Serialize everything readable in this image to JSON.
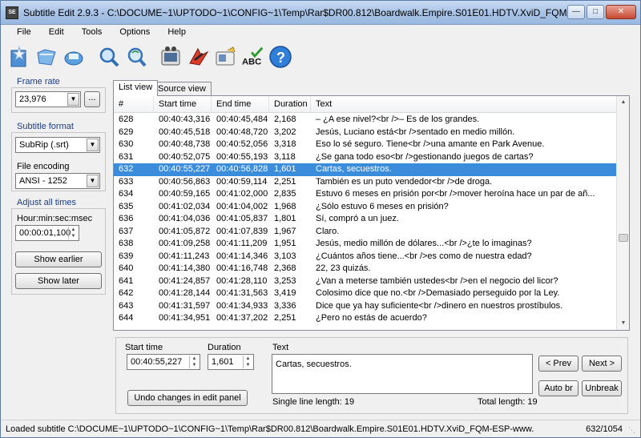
{
  "window": {
    "title": "Subtitle Edit 2.9.3 - C:\\DOCUME~1\\UPTODO~1\\CONFIG~1\\Temp\\Rar$DR00.812\\Boardwalk.Empire.S01E01.HDTV.XviD_FQM-ESP-www...",
    "app_icon_text": "SE"
  },
  "menu": [
    "File",
    "Edit",
    "Tools",
    "Options",
    "Help"
  ],
  "toolbar": {
    "icons": [
      "wizard-icon",
      "open-file-icon",
      "save-icon",
      "find-icon",
      "replace-icon",
      "video-icon",
      "fix-errors-icon",
      "spellcheck-icon",
      "help-icon"
    ],
    "spellcheck_label": "ABC"
  },
  "left_panel": {
    "frame_rate_label": "Frame rate",
    "frame_rate_value": "23,976",
    "frame_rate_browse": "...",
    "subtitle_format_label": "Subtitle format",
    "subtitle_format_value": "SubRip (.srt)",
    "file_encoding_label": "File encoding",
    "file_encoding_value": "ANSI - 1252",
    "adjust_label": "Adjust all times",
    "hms_label": "Hour:min:sec:msec",
    "adjust_value": "00:00:01,100",
    "show_earlier": "Show earlier",
    "show_later": "Show later"
  },
  "tabs": [
    "List view",
    "Source view"
  ],
  "grid": {
    "columns": [
      "#",
      "Start time",
      "End time",
      "Duration",
      "Text"
    ],
    "rows": [
      [
        "628",
        "00:40:43,316",
        "00:40:45,484",
        "2,168",
        "– ¿A ese nivel?<br />– Es de los grandes."
      ],
      [
        "629",
        "00:40:45,518",
        "00:40:48,720",
        "3,202",
        "Jesús, Luciano está<br />sentado en medio millón."
      ],
      [
        "630",
        "00:40:48,738",
        "00:40:52,056",
        "3,318",
        "Eso lo sé seguro. Tiene<br />una amante en Park Avenue."
      ],
      [
        "631",
        "00:40:52,075",
        "00:40:55,193",
        "3,118",
        "¿Se gana todo eso<br />gestionando juegos de cartas?"
      ],
      [
        "632",
        "00:40:55,227",
        "00:40:56,828",
        "1,601",
        "Cartas, secuestros."
      ],
      [
        "633",
        "00:40:56,863",
        "00:40:59,114",
        "2,251",
        "También es un puto vendedor<br />de droga."
      ],
      [
        "634",
        "00:40:59,165",
        "00:41:02,000",
        "2,835",
        "Estuvo 6 meses en prisión por<br />mover heroína hace un par de añ..."
      ],
      [
        "635",
        "00:41:02,034",
        "00:41:04,002",
        "1,968",
        "¿Sólo estuvo 6 meses en prisión?"
      ],
      [
        "636",
        "00:41:04,036",
        "00:41:05,837",
        "1,801",
        "Sí, compró a un juez."
      ],
      [
        "637",
        "00:41:05,872",
        "00:41:07,839",
        "1,967",
        "Claro."
      ],
      [
        "638",
        "00:41:09,258",
        "00:41:11,209",
        "1,951",
        "Jesús, medio millón de dólares...<br />¿te lo imaginas?"
      ],
      [
        "639",
        "00:41:11,243",
        "00:41:14,346",
        "3,103",
        "¿Cuántos años tiene...<br />es como de nuestra edad?"
      ],
      [
        "640",
        "00:41:14,380",
        "00:41:16,748",
        "2,368",
        "22, 23 quizás."
      ],
      [
        "641",
        "00:41:24,857",
        "00:41:28,110",
        "3,253",
        "¿Van a meterse también ustedes<br />en el negocio del licor?"
      ],
      [
        "642",
        "00:41:28,144",
        "00:41:31,563",
        "3,419",
        "Colosimo dice que no.<br />Demasiado perseguido por la Ley."
      ],
      [
        "643",
        "00:41:31,597",
        "00:41:34,933",
        "3,336",
        "Dice que ya hay suficiente<br />dinero en nuestros prostíbulos."
      ],
      [
        "644",
        "00:41:34,951",
        "00:41:37,202",
        "2,251",
        "¿Pero no estás de acuerdo?"
      ]
    ],
    "selected_index": 4
  },
  "edit_panel": {
    "start_time_label": "Start time",
    "start_time_value": "00:40:55,227",
    "duration_label": "Duration",
    "duration_value": "1,601",
    "text_label": "Text",
    "text_value": "Cartas, secuestros.",
    "undo_button": "Undo changes in edit panel",
    "single_line_label": "Single line length:  19",
    "total_length_label": "Total length:  19",
    "prev_button": "< Prev",
    "next_button": "Next >",
    "auto_br_button": "Auto br",
    "unbreak_button": "Unbreak"
  },
  "status": {
    "left": "Loaded subtitle C:\\DOCUME~1\\UPTODO~1\\CONFIG~1\\Temp\\Rar$DR00.812\\Boardwalk.Empire.S01E01.HDTV.XviD_FQM-ESP-www.SubAdictos.N",
    "right": "632/1054"
  }
}
